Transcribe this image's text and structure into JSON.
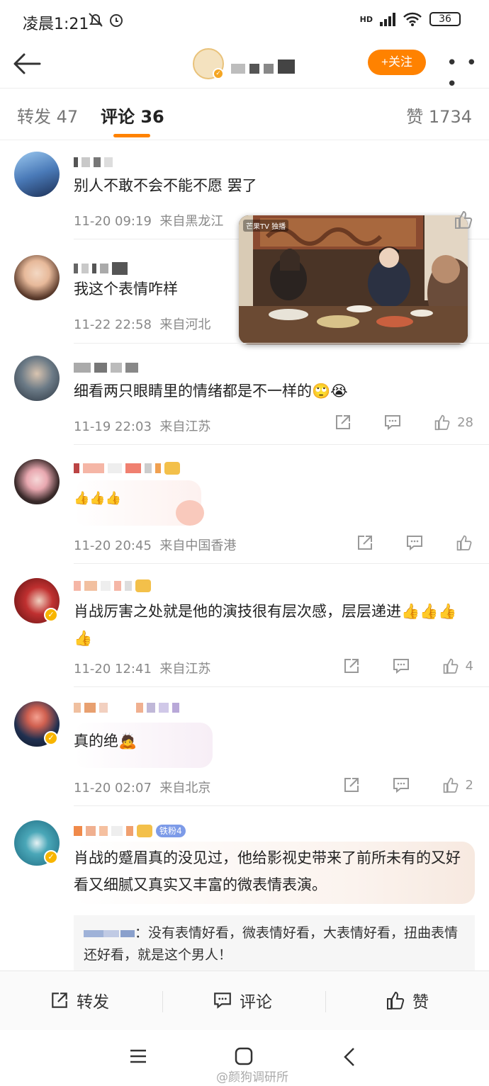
{
  "status_bar": {
    "time": "凌晨1:21",
    "network": "HD",
    "battery": "36"
  },
  "nav": {
    "follow_label": "+关注",
    "more_label": "• • •"
  },
  "tabs": {
    "repost": "转发 47",
    "comment": "评论 36",
    "like": "赞 1734"
  },
  "video": {
    "channel_label": "芒果TV 独播"
  },
  "comments": [
    {
      "text": "别人不敢不会不能不愿 罢了",
      "time": "11-20 09:19",
      "location": "来自黑龙江",
      "likes": ""
    },
    {
      "text": "我这个表情咋样",
      "time": "11-22 22:58",
      "location": "来自河北",
      "likes": ""
    },
    {
      "text": "细看两只眼睛里的情绪都是不一样的🙄😭",
      "time": "11-19 22:03",
      "location": "来自江苏",
      "likes": "28"
    },
    {
      "text": "👍👍👍",
      "time": "11-20 20:45",
      "location": "来自中国香港",
      "likes": ""
    },
    {
      "text": "肖战厉害之处就是他的演技很有层次感，层层递进👍👍👍👍",
      "time": "11-20 12:41",
      "location": "来自江苏",
      "likes": "4"
    },
    {
      "text": "真的绝🙇",
      "time": "11-20 02:07",
      "location": "来自北京",
      "likes": "2"
    },
    {
      "text": "肖战的蹙眉真的没见过，他给影视史带来了前所未有的又好看又细腻又真实又丰富的微表情表演。",
      "badge": "铁粉4"
    }
  ],
  "reply": {
    "text": "：没有表情好看，微表情好看，大表情好看，扭曲表情还好看，就是这个男人！"
  },
  "bottom_bar": {
    "repost": "转发",
    "comment": "评论",
    "like": "赞"
  },
  "watermark": "@颜狗调研所",
  "colors": {
    "accent": "#ff8200",
    "meta_text": "#888888",
    "badge_blue": "#7d9be8"
  }
}
